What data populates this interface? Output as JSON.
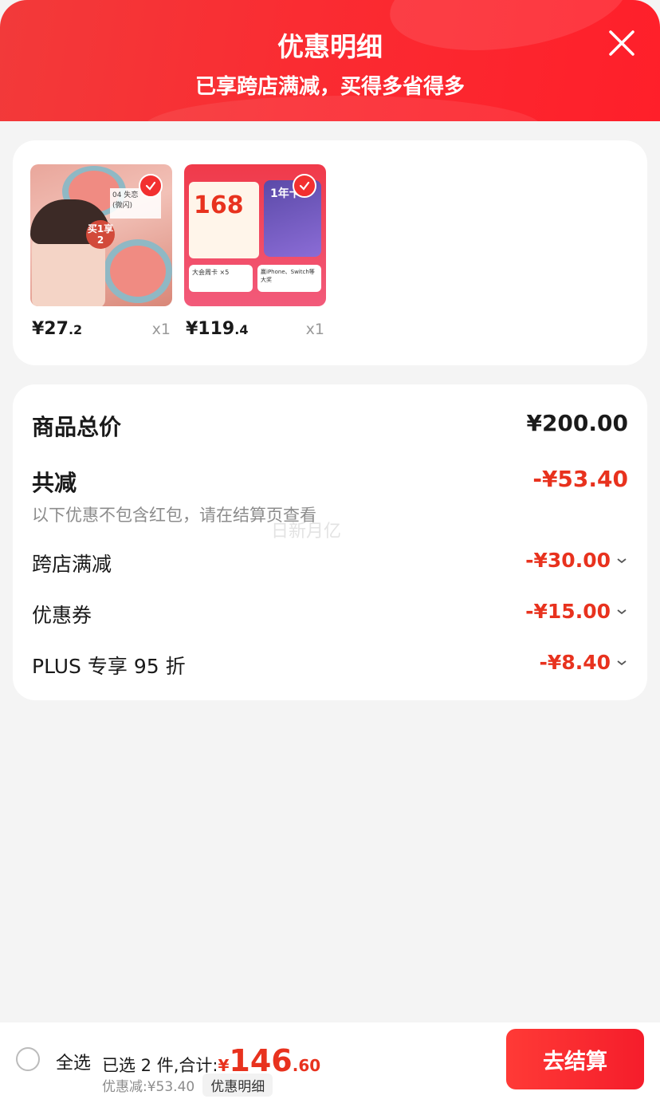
{
  "header": {
    "title": "优惠明细",
    "subtitle": "已享跨店满减，买得多省得多"
  },
  "products": [
    {
      "price_int": "¥27",
      "price_dec": ".2",
      "qty": "x1",
      "thumb_badge": "04 失恋",
      "thumb_tag": "买1享2",
      "thumb_sub": "(微闪)"
    },
    {
      "price_int": "¥119",
      "price_dec": ".4",
      "qty": "x1",
      "thumb_big": "168",
      "thumb_card": "1年卡",
      "thumb_bottom_left": "大会周卡 ×5",
      "thumb_bottom_right": "赢iPhone、Switch等大奖"
    }
  ],
  "summary": {
    "total_label": "商品总价",
    "total_value": "¥200.00",
    "discount_label": "共减",
    "discount_value": "-¥53.40",
    "note": "以下优惠不包含红包，请在结算页查看",
    "items": [
      {
        "label": "跨店满减",
        "value": "-¥30.00"
      },
      {
        "label": "优惠券",
        "value": "-¥15.00"
      },
      {
        "label": "PLUS 专享 95 折",
        "value": "-¥8.40"
      }
    ]
  },
  "watermark": "日新月亿",
  "bottom": {
    "select_all": "全选",
    "selected_text": "已选 2 件,合计:",
    "total_yen": "¥",
    "total_int": "146",
    "total_dec": ".60",
    "discount_text": "优惠减:¥53.40",
    "detail_label": "优惠明细",
    "checkout_label": "去结算"
  },
  "colors": {
    "accent_red": "#e8321e",
    "header_red": "#fa2c32"
  }
}
